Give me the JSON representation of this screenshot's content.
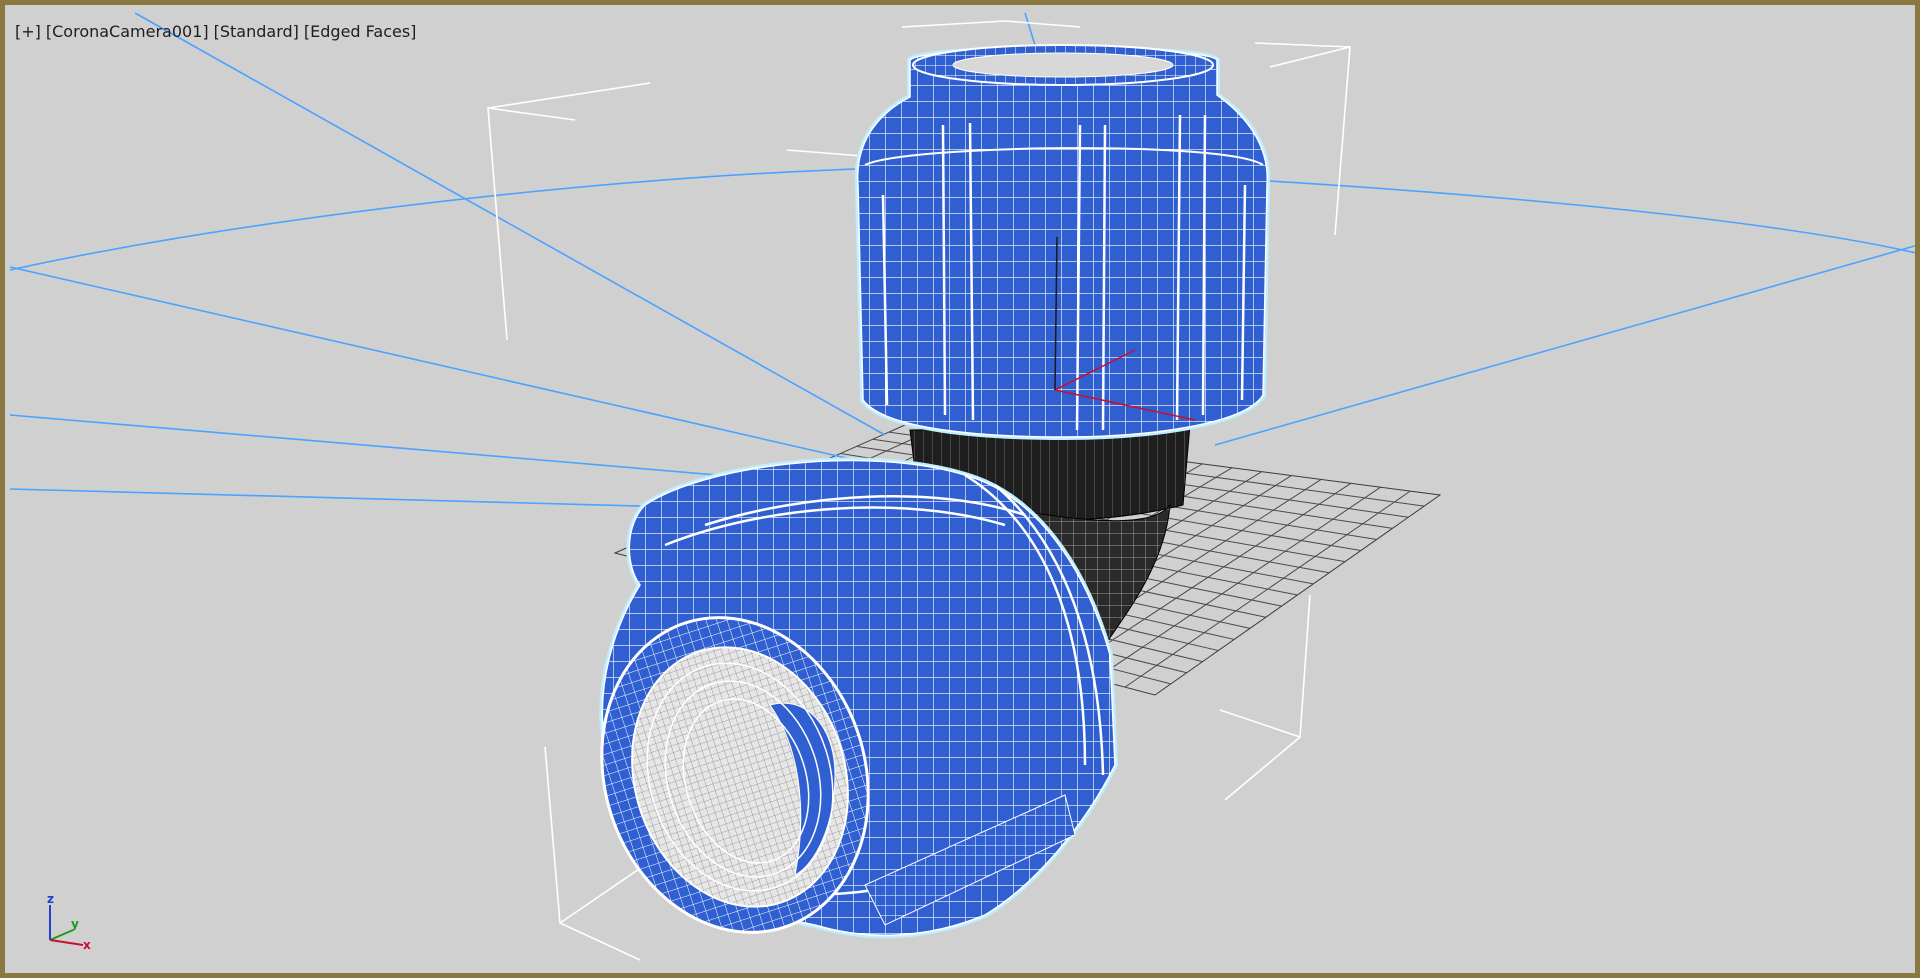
{
  "viewport": {
    "menu_plus": "[+]",
    "camera": "[CoronaCamera001]",
    "shading": "[Standard]",
    "display_mode": "[Edged Faces]"
  },
  "axis_tripod": {
    "z": "z",
    "y": "y",
    "x": "x"
  },
  "colors": {
    "background": "#d0d0d0",
    "frame": "#8a7840",
    "model_blue": "#2f5fd0",
    "selection_outline": "#bfefff",
    "camera_lines": "#4aa3ff",
    "grid": "#4a4a4a",
    "dark_band": "#1e1e1e",
    "gizmo_red": "#c8102e"
  },
  "scene_objects": [
    "pipe-elbow-fitting",
    "home-grid",
    "camera-cone",
    "selection-bracket"
  ]
}
